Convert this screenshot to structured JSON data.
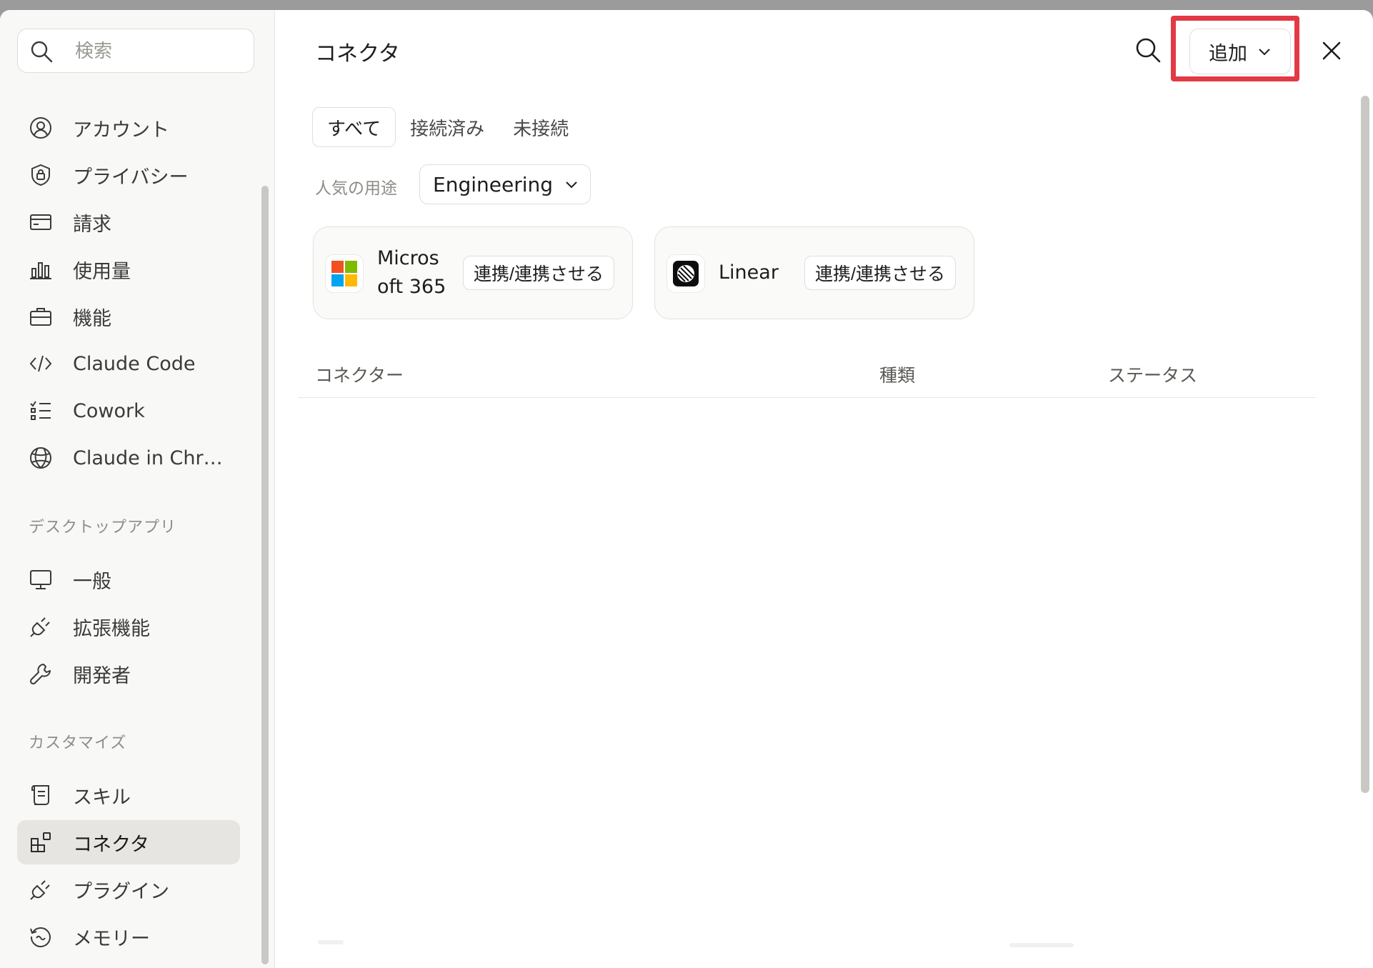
{
  "sidebar": {
    "search_placeholder": "検索",
    "items_top": [
      {
        "label": "アカウント",
        "icon": "user-circle-icon"
      },
      {
        "label": "プライバシー",
        "icon": "shield-lock-icon"
      },
      {
        "label": "請求",
        "icon": "credit-card-icon"
      },
      {
        "label": "使用量",
        "icon": "bar-chart-icon"
      },
      {
        "label": "機能",
        "icon": "briefcase-icon"
      },
      {
        "label": "Claude Code",
        "icon": "code-icon"
      },
      {
        "label": "Cowork",
        "icon": "checklist-icon"
      },
      {
        "label": "Claude in Chr…",
        "icon": "globe-icon"
      }
    ],
    "section_desktop": "デスクトップアプリ",
    "items_desktop": [
      {
        "label": "一般",
        "icon": "monitor-icon"
      },
      {
        "label": "拡張機能",
        "icon": "plug-icon"
      },
      {
        "label": "開発者",
        "icon": "wrench-icon"
      }
    ],
    "section_customize": "カスタマイズ",
    "items_customize": [
      {
        "label": "スキル",
        "icon": "scroll-icon"
      },
      {
        "label": "コネクタ",
        "icon": "blocks-icon",
        "active": true
      },
      {
        "label": "プラグイン",
        "icon": "plug-icon"
      },
      {
        "label": "メモリー",
        "icon": "history-icon"
      }
    ]
  },
  "main": {
    "title": "コネクタ",
    "add_label": "追加",
    "tabs": [
      {
        "label": "すべて",
        "active": true
      },
      {
        "label": "接続済み",
        "active": false
      },
      {
        "label": "未接続",
        "active": false
      }
    ],
    "popular_label": "人気の用途",
    "popular_value": "Engineering",
    "cards": [
      {
        "name_line1": "Micros",
        "name_line2": "oft 365",
        "button": "連携/連携させる",
        "icon": "microsoft-icon"
      },
      {
        "name_line1": "Linear",
        "name_line2": "",
        "button": "連携/連携させる",
        "icon": "linear-icon"
      }
    ],
    "table": {
      "columns": [
        "コネクター",
        "種類",
        "ステータス"
      ]
    }
  },
  "colors": {
    "highlight": "#e23a45",
    "active_item_bg": "#e6e5e2",
    "ms_red": "#f25022",
    "ms_green": "#7fba00",
    "ms_blue": "#00a4ef",
    "ms_yellow": "#ffb900"
  }
}
